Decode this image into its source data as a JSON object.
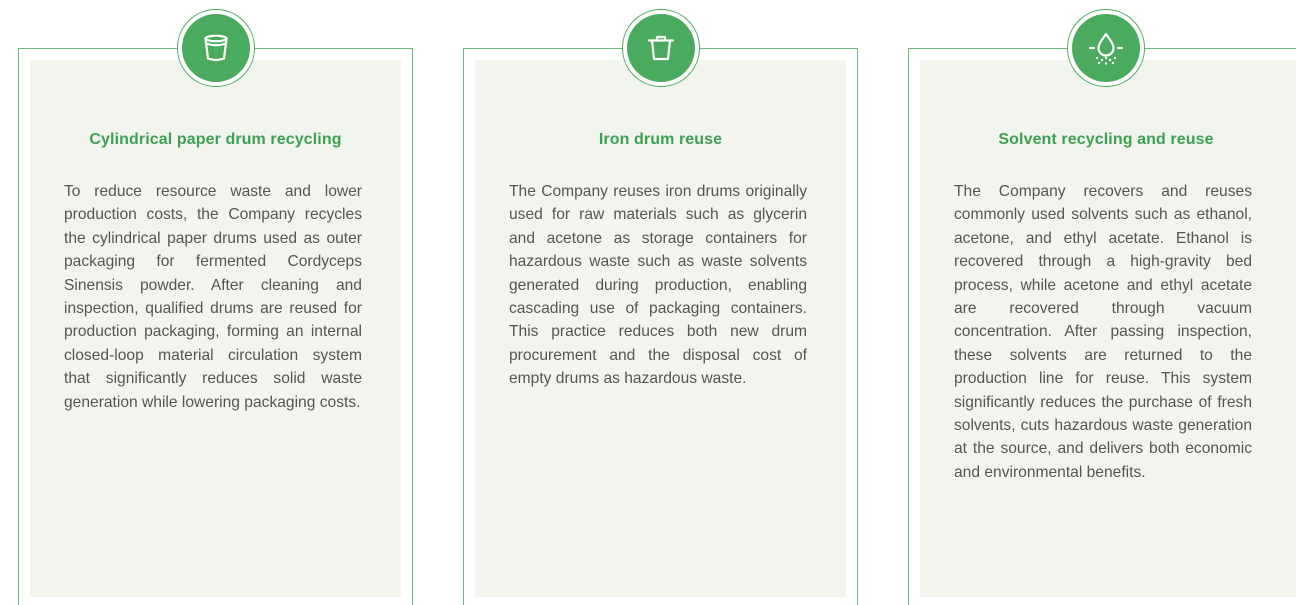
{
  "colors": {
    "accent": "#4aaa5d",
    "title": "#3f9f52",
    "panel_background": "#f1f5ee",
    "border": "#6fba7c",
    "body_text": "#555555"
  },
  "cards": [
    {
      "icon": "paper-cup-icon",
      "title": "Cylindrical paper drum recycling",
      "body": "To reduce resource waste and lower production costs, the Com­pany recycles the cylindrical paper drums used as outer packaging for fermented Cordyceps Sinensis powder. After cleaning and inspec­tion, qualified drums are reused for production packaging, forming an internal closed-loop material circulation system that significant­ly reduces solid waste generation while lowering packaging costs."
    },
    {
      "icon": "trash-bin-icon",
      "title": "Iron drum reuse",
      "body": "The Company reuses iron drums originally used for raw materials such as glycerin and acetone as storage containers for hazardous waste such as waste solvents gen­erated during production, enabling cascading use of packaging con­tainers. This practice reduces both new drum procurement and the disposal cost of empty drums as hazardous waste."
    },
    {
      "icon": "water-drop-icon",
      "title": "Solvent recycling and reuse",
      "body": "The Company recovers and reuses commonly used solvents such as ethanol, acetone, and ethyl acetate. Ethanol is recovered through a high-gravity bed process, while ace­tone and ethyl acetate are recovered through vacuum concentration. After passing inspection, these solvents are returned to the production line for reuse. This system significantly reduces the purchase of fresh sol­vents, cuts hazardous waste gen­eration at the source, and delivers both economic and environmental benefits."
    }
  ]
}
